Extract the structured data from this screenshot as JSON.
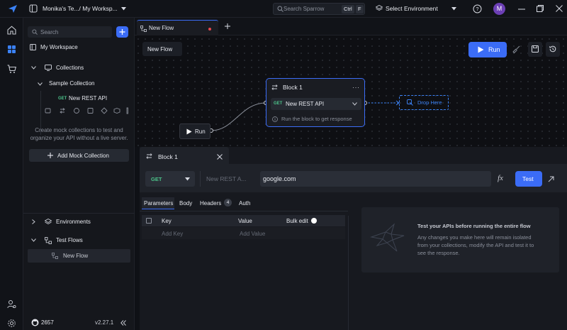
{
  "titlebar": {
    "workspace_path": "Monika's Te.../ My Worksp...",
    "search_placeholder": "Search Sparrow",
    "search_kbd_1": "Ctrl",
    "search_kbd_2": "F",
    "environment": "Select Environment",
    "avatar_letter": "M"
  },
  "sidebar": {
    "search_placeholder": "Search",
    "workspace": "My Workspace",
    "collections_label": "Collections",
    "sample_collection": "Sample Collection",
    "request_method": "GET",
    "request_name": "New REST API",
    "mock_info_line1": "Create mock collections to test and",
    "mock_info_line2": "organize your API without a live server.",
    "add_mock_label": "Add Mock Collection",
    "environments_label": "Environments",
    "test_flows_label": "Test Flows",
    "flow_item": "New Flow",
    "github_count": "2657",
    "version": "v2.27.1"
  },
  "tabs": {
    "active_tab": "New Flow"
  },
  "canvas": {
    "flow_name": "New Flow",
    "run_label": "Run",
    "start_run_label": "Run",
    "block_title": "Block 1",
    "block_method": "GET",
    "block_request": "New REST API",
    "block_hint": "Run the block to get response",
    "drop_here": "Drop Here"
  },
  "panel": {
    "title": "Block 1",
    "method": "GET",
    "request_name_placeholder": "New REST A...",
    "url": "google.com",
    "test_label": "Test",
    "tabs": [
      {
        "label": "Parameters"
      },
      {
        "label": "Body"
      },
      {
        "label": "Headers",
        "badge": "4"
      },
      {
        "label": "Auth"
      }
    ],
    "table_headers": {
      "key": "Key",
      "value": "Value",
      "bulk_edit": "Bulk edit"
    },
    "add_key_placeholder": "Add Key",
    "add_value_placeholder": "Add Value",
    "info_title": "Test your APIs before running the entire flow",
    "info_line1": "Any changes you make here will remain isolated",
    "info_line2": "from your collections, modify the API and test it to",
    "info_line3": "see the response."
  },
  "colors": {
    "accent": "#3b6cf6",
    "get_method": "#4cc38a",
    "tab_dot": "#e5484d"
  }
}
